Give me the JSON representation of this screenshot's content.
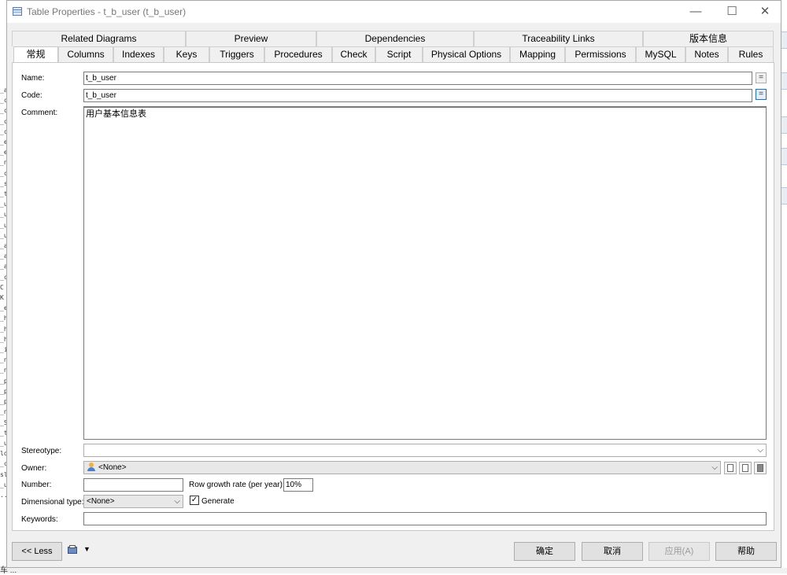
{
  "background": {
    "left_strip_chars": [
      "_a",
      "_c",
      "_c",
      "_c",
      "_c",
      "_e",
      "_e",
      "_n",
      "_c",
      "_s",
      "_ti",
      "_u",
      "_u",
      "_u",
      "_u",
      "_a",
      "_a",
      "_a",
      "_c",
      "C",
      "K",
      "_e",
      "_h",
      "_h",
      "_h",
      "_it",
      "_n",
      "_n",
      "_p",
      "_p",
      "_p",
      "_n",
      "_S",
      "_t",
      "_u",
      "lo",
      "_c",
      "sl",
      "_u",
      "..."
    ],
    "bottom_label": "车 ..."
  },
  "dialog": {
    "title": "Table Properties - t_b_user (t_b_user)",
    "minimize": "—",
    "maximize": "☐",
    "close": "✕"
  },
  "tabs_row1": [
    "Related Diagrams",
    "Preview",
    "Dependencies",
    "Traceability Links",
    "版本信息"
  ],
  "tabs_row2": [
    "常规",
    "Columns",
    "Indexes",
    "Keys",
    "Triggers",
    "Procedures",
    "Check",
    "Script",
    "Physical Options",
    "Mapping",
    "Permissions",
    "MySQL",
    "Notes",
    "Rules"
  ],
  "form": {
    "name_label": "Name:",
    "name_value": "t_b_user",
    "code_label": "Code:",
    "code_value": "t_b_user",
    "comment_label": "Comment:",
    "comment_value": "用户基本信息表",
    "stereotype_label": "Stereotype:",
    "stereotype_value": "",
    "owner_label": "Owner:",
    "owner_value": "<None>",
    "number_label": "Number:",
    "number_value": "",
    "row_growth_label": "Row growth rate (per year):",
    "row_growth_value": "10%",
    "dimensional_label": "Dimensional type:",
    "dimensional_value": "<None>",
    "generate_label": "Generate",
    "generate_checked": true,
    "keywords_label": "Keywords:",
    "keywords_value": "",
    "eq_symbol": "="
  },
  "footer": {
    "less_button": "<< Less",
    "ok_button": "确定",
    "cancel_button": "取消",
    "apply_button": "应用(A)",
    "help_button": "帮助"
  }
}
